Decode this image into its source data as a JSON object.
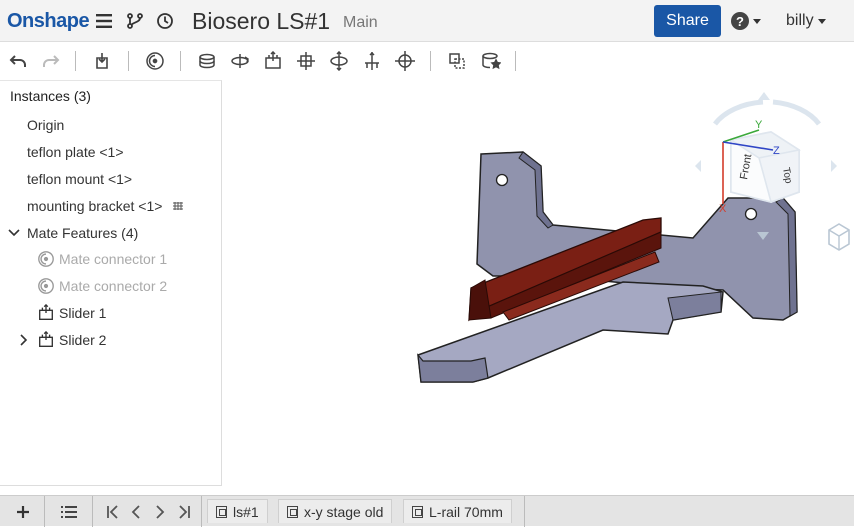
{
  "header": {
    "logo": "Onshape",
    "document_title": "Biosero LS#1",
    "branch": "Main",
    "share_label": "Share",
    "help_label": "?",
    "user_name": "billy",
    "icons": [
      "menu-icon",
      "branch-icon",
      "history-icon"
    ]
  },
  "toolbar": {
    "icons": [
      "undo-icon",
      "redo-icon",
      "insert-part-icon",
      "mate-connector-icon",
      "fastened-mate-icon",
      "revolute-mate-icon",
      "slider-mate-icon",
      "planar-mate-icon",
      "cylindrical-mate-icon",
      "pin-slot-mate-icon",
      "ball-mate-icon",
      "linear-pattern-icon",
      "replicate-icon"
    ]
  },
  "instances": {
    "header": "Instances (3)",
    "items": [
      {
        "label": "Origin"
      },
      {
        "label": "teflon plate <1>"
      },
      {
        "label": "teflon mount <1>"
      },
      {
        "label": "mounting bracket <1>"
      }
    ],
    "mate_features": {
      "label": "Mate Features (4)",
      "items": [
        {
          "label": "Mate connector 1"
        },
        {
          "label": "Mate connector 2"
        },
        {
          "label": "Slider 1"
        },
        {
          "label": "Slider 2"
        }
      ]
    }
  },
  "viewcube": {
    "front": "Front",
    "top": "Top",
    "axis_x": "X",
    "axis_y": "Y",
    "axis_z": "Z"
  },
  "tabs": [
    {
      "label": "ls#1"
    },
    {
      "label": "x-y stage old"
    },
    {
      "label": "L-rail 70mm"
    }
  ],
  "colors": {
    "brand": "#1a57a6",
    "part_body": "#8b8ea8",
    "rail": "#6e1c12"
  }
}
